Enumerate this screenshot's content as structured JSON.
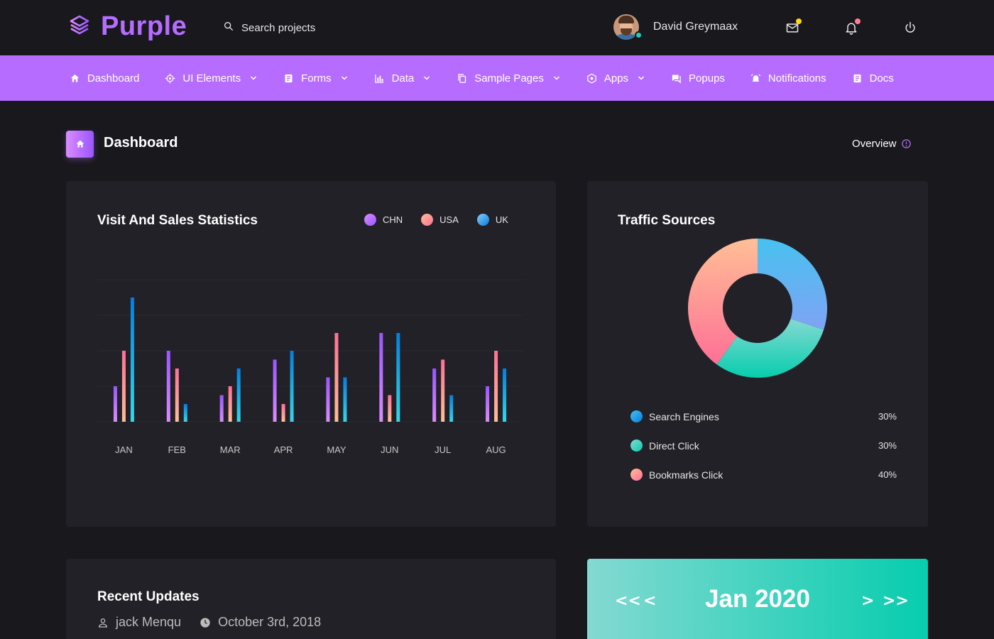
{
  "brand": {
    "name": "Purple",
    "color": "#b66dff"
  },
  "search": {
    "placeholder": "Search projects"
  },
  "user": {
    "name": "David Greymaax"
  },
  "top_icons": [
    {
      "name": "mail-icon",
      "badge_color": "#fed713"
    },
    {
      "name": "bell-icon",
      "badge_color": "#fe7c96"
    },
    {
      "name": "power-icon"
    }
  ],
  "nav": [
    {
      "label": "Dashboard",
      "icon": "home-icon",
      "has_dropdown": false
    },
    {
      "label": "UI Elements",
      "icon": "crosshairs-icon",
      "has_dropdown": true
    },
    {
      "label": "Forms",
      "icon": "form-icon",
      "has_dropdown": true
    },
    {
      "label": "Data",
      "icon": "chart-icon",
      "has_dropdown": true
    },
    {
      "label": "Sample Pages",
      "icon": "copy-icon",
      "has_dropdown": true
    },
    {
      "label": "Apps",
      "icon": "apps-icon",
      "has_dropdown": true
    },
    {
      "label": "Popups",
      "icon": "chat-icon",
      "has_dropdown": false
    },
    {
      "label": "Notifications",
      "icon": "alarm-icon",
      "has_dropdown": false
    },
    {
      "label": "Docs",
      "icon": "doc-icon",
      "has_dropdown": false
    }
  ],
  "page": {
    "title": "Dashboard",
    "overview_label": "Overview"
  },
  "visit_card": {
    "title": "Visit And Sales Statistics"
  },
  "chart_data": [
    {
      "type": "bar",
      "title": "Visit And Sales Statistics",
      "categories": [
        "JAN",
        "FEB",
        "MAR",
        "APR",
        "MAY",
        "JUN",
        "JUL",
        "AUG"
      ],
      "series": [
        {
          "name": "CHN",
          "color": "#b66dff",
          "values": [
            20,
            40,
            15,
            35,
            25,
            50,
            30,
            20
          ]
        },
        {
          "name": "USA",
          "color": "#fe9496",
          "values": [
            40,
            30,
            20,
            10,
            50,
            15,
            35,
            40
          ]
        },
        {
          "name": "UK",
          "color": "#47c1ef",
          "values": [
            70,
            10,
            30,
            40,
            25,
            50,
            15,
            30
          ]
        }
      ],
      "ylim": [
        0,
        80
      ],
      "grid": true,
      "legend_position": "top-right"
    },
    {
      "type": "pie",
      "title": "Traffic Sources",
      "categories": [
        "Search Engines",
        "Direct Click",
        "Bookmarks Click"
      ],
      "values": [
        30,
        30,
        40
      ],
      "value_labels": [
        "30%",
        "30%",
        "40%"
      ],
      "colors": [
        "#47c1ef",
        "#1bcfb4",
        "#fe7c96"
      ],
      "donut": true
    }
  ],
  "traffic_card": {
    "title": "Traffic Sources"
  },
  "updates_card": {
    "title": "Recent Updates",
    "author": "jack Menqu",
    "date": "October 3rd, 2018"
  },
  "calendar": {
    "month": "Jan 2020",
    "prev_year": "<<",
    "prev": "<",
    "next": ">",
    "next_year": ">>"
  }
}
